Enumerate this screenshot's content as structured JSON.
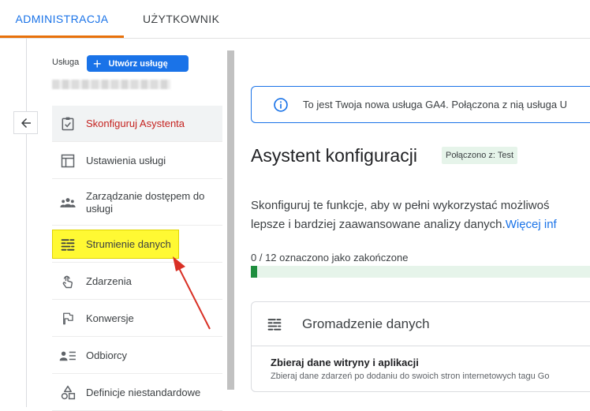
{
  "tabs": [
    {
      "label": "ADMINISTRACJA",
      "active": true
    },
    {
      "label": "UŻYTKOWNIK",
      "active": false
    }
  ],
  "sidebar": {
    "service_label": "Usługa",
    "create_button": "Utwórz usługę",
    "items": [
      {
        "label": "Skonfiguruj Asystenta",
        "icon": "checklist-icon",
        "active": true
      },
      {
        "label": "Ustawienia usługi",
        "icon": "layout-icon"
      },
      {
        "label": "Zarządzanie dostępem do usługi",
        "icon": "people-icon"
      },
      {
        "label": "Strumienie danych",
        "icon": "data-streams-icon",
        "highlighted": true
      },
      {
        "label": "Zdarzenia",
        "icon": "touch-icon"
      },
      {
        "label": "Konwersje",
        "icon": "flag-icon"
      },
      {
        "label": "Odbiorcy",
        "icon": "audience-icon"
      },
      {
        "label": "Definicje niestandardowe",
        "icon": "shapes-icon"
      }
    ]
  },
  "main": {
    "info_banner": "To jest Twoja nowa usługa GA4. Połączona z nią usługa U",
    "title": "Asystent konfiguracji",
    "connected_chip": "Połączono z: Test",
    "description_line1": "Skonfiguruj te funkcje, aby w pełni wykorzystać możliwoś",
    "description_line2": "lepsze i bardziej zaawansowane analizy danych.",
    "more_link": "Więcej inf",
    "progress_label": "0 / 12 oznaczono jako zakończone",
    "progress_completed": 0,
    "progress_total": 12,
    "card": {
      "title": "Gromadzenie danych",
      "subtitle": "Zbieraj dane witryny i aplikacji",
      "subdesc": "Zbieraj dane zdarzeń po dodaniu do swoich stron internetowych tagu Go"
    }
  },
  "colors": {
    "accent": "#1a73e8",
    "tab_indicator": "#e8710a",
    "active_item": "#c5221f",
    "highlight": "#fff933",
    "annotation_arrow": "#d93025",
    "progress_fill": "#1e8e3e"
  }
}
